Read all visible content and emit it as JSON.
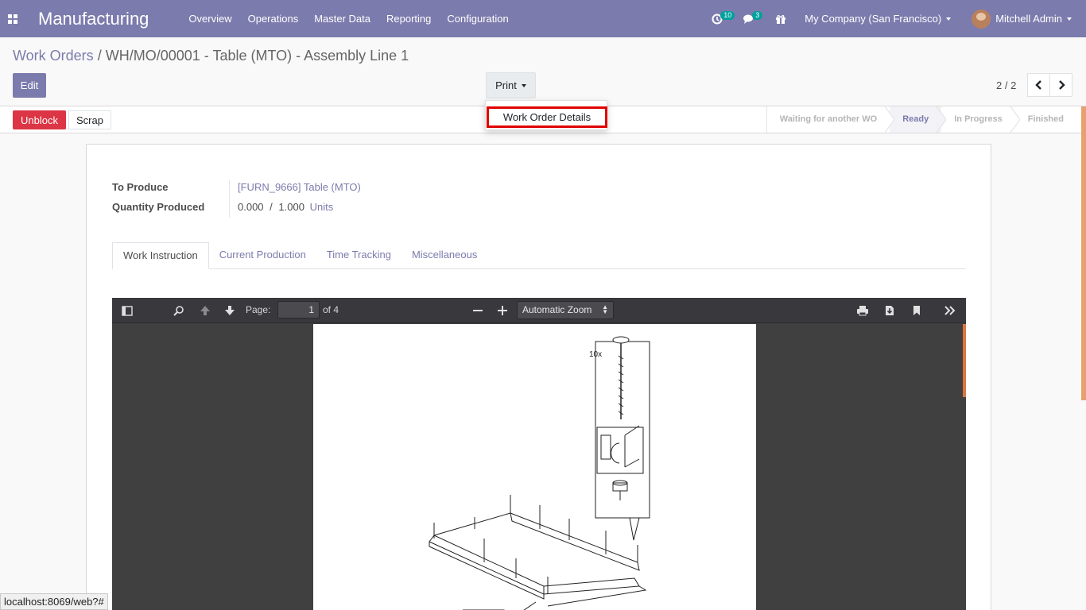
{
  "navbar": {
    "app_title": "Manufacturing",
    "menu": [
      "Overview",
      "Operations",
      "Master Data",
      "Reporting",
      "Configuration"
    ],
    "activity_count": "10",
    "message_count": "3",
    "company": "My Company (San Francisco)",
    "user": "Mitchell Admin"
  },
  "breadcrumb": {
    "parent": "Work Orders",
    "separator": "/",
    "current": "WH/MO/00001 - Table (MTO) - Assembly Line 1"
  },
  "control": {
    "edit_label": "Edit",
    "print_label": "Print",
    "print_menu_item": "Work Order Details",
    "pager_value": "2 / 2"
  },
  "statusbar": {
    "unblock_label": "Unblock",
    "scrap_label": "Scrap",
    "stages": [
      "Waiting for another WO",
      "Ready",
      "In Progress",
      "Finished"
    ],
    "active_stage": "Ready"
  },
  "form": {
    "to_produce_label": "To Produce",
    "to_produce_value": "[FURN_9666] Table (MTO)",
    "qty_label": "Quantity Produced",
    "qty_produced": "0.000",
    "qty_sep": "/",
    "qty_total": "1.000",
    "qty_uom": "Units",
    "tabs": [
      "Work Instruction",
      "Current Production",
      "Time Tracking",
      "Miscellaneous"
    ],
    "active_tab": "Work Instruction"
  },
  "pdf_viewer": {
    "page_label": "Page:",
    "page_number": "1",
    "page_count": "of 4",
    "zoom": "Automatic Zoom",
    "drawing_text": "10x"
  },
  "status_url": "localhost:8069/web?#"
}
